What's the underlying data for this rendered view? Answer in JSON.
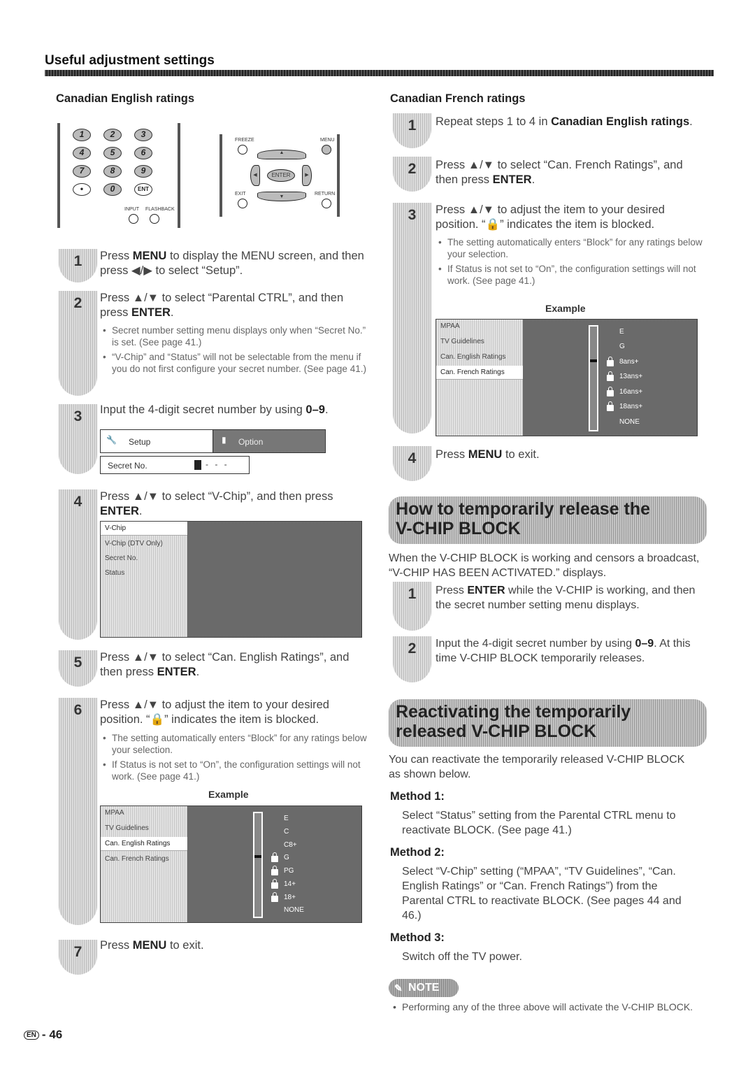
{
  "page": {
    "header": "Useful adjustment settings",
    "number": "46",
    "lang_badge": "EN",
    "separator": "-"
  },
  "english": {
    "title": "Canadian English ratings",
    "remote_numpad": {
      "buttons": [
        "1",
        "2",
        "3",
        "4",
        "5",
        "6",
        "7",
        "8",
        "9",
        "•",
        "0",
        "ENT"
      ],
      "labels": [
        "INPUT",
        "FLASHBACK"
      ]
    },
    "remote_dpad": {
      "labels": [
        "FREEZE",
        "MENU",
        "EXIT",
        "RETURN"
      ],
      "center": "ENTER"
    },
    "steps": [
      {
        "num": "1",
        "parts": [
          "Press ",
          "MENU",
          " to display the MENU screen, and then press ◀/▶ to select “Setup”."
        ]
      },
      {
        "num": "2",
        "parts": [
          "Press ▲/▼ to select “Parental CTRL”, and then press ",
          "ENTER",
          "."
        ],
        "bullets": [
          "Secret number setting menu displays only when “Secret No.” is set. (See page 41.)",
          "“V-Chip” and “Status” will not be selectable from the menu if you do not first configure your secret number. (See page 41.)"
        ]
      },
      {
        "num": "3",
        "parts": [
          "Input the 4-digit secret number by using ",
          "0–9",
          "."
        ]
      },
      {
        "num": "4",
        "parts": [
          "Press ▲/▼ to select “V-Chip”, and then press ",
          "ENTER",
          "."
        ]
      },
      {
        "num": "5",
        "parts": [
          "Press ▲/▼ to select “Can. English Ratings”, and then press ",
          "ENTER",
          "."
        ]
      },
      {
        "num": "6",
        "parts": [
          "Press ▲/▼ to adjust the item to your desired position. “🔒” indicates the item is blocked.",
          "",
          ""
        ],
        "bullets": [
          "The setting automatically enters “Block” for any ratings below your selection.",
          "If Status is not set to “On”, the configuration settings will not work. (See page 41.)"
        ]
      },
      {
        "num": "7",
        "parts": [
          "Press ",
          "MENU",
          " to exit."
        ]
      }
    ],
    "setup_screen": {
      "tab_active": "Setup",
      "tab_inactive": "Option",
      "field_label": "Secret No.",
      "field_value": "- - -"
    },
    "vchip_screen": {
      "selected": "V-Chip",
      "items": [
        "V-Chip (DTV Only)",
        "Secret No.",
        "Status"
      ]
    },
    "example_label": "Example",
    "example_screen": {
      "menu": [
        "MPAA",
        "TV Guidelines",
        "Can. English Ratings",
        "Can. French Ratings"
      ],
      "selected_index": 2,
      "ratings": [
        "E",
        "C",
        "C8+",
        "G",
        "PG",
        "14+",
        "18+",
        "NONE"
      ],
      "locked": [
        false,
        false,
        false,
        true,
        true,
        true,
        true,
        false
      ]
    }
  },
  "french": {
    "title": "Canadian French ratings",
    "steps": [
      {
        "num": "1",
        "parts": [
          "Repeat steps 1 to 4 in ",
          "Canadian English ratings",
          "."
        ]
      },
      {
        "num": "2",
        "parts": [
          "Press ▲/▼ to select “Can. French Ratings”, and then press ",
          "ENTER",
          "."
        ]
      },
      {
        "num": "3",
        "parts": [
          "Press ▲/▼ to adjust the item to your desired position. “🔒” indicates the item is blocked.",
          "",
          ""
        ],
        "bullets": [
          "The setting automatically enters “Block” for any ratings below your selection.",
          "If Status is not set to “On”, the configuration settings will not work. (See page 41.)"
        ]
      },
      {
        "num": "4",
        "parts": [
          "Press ",
          "MENU",
          " to exit."
        ]
      }
    ],
    "example_label": "Example",
    "example_screen": {
      "menu": [
        "MPAA",
        "TV Guidelines",
        "Can. English Ratings",
        "Can. French Ratings"
      ],
      "selected_index": 3,
      "ratings": [
        "E",
        "G",
        "8ans+",
        "13ans+",
        "16ans+",
        "18ans+",
        "NONE"
      ],
      "locked": [
        false,
        false,
        true,
        true,
        true,
        true,
        false
      ]
    }
  },
  "release": {
    "title_line1": "How to temporarily release the",
    "title_line2": "V-CHIP BLOCK",
    "intro": "When the V-CHIP BLOCK is working and censors a broadcast, “V-CHIP HAS BEEN ACTIVATED.” displays.",
    "steps": [
      {
        "num": "1",
        "parts": [
          "Press ",
          "ENTER",
          " while the V-CHIP is working, and then the secret number setting menu displays."
        ]
      },
      {
        "num": "2",
        "parts": [
          "Input the 4-digit secret number by using ",
          "0–9",
          ". At this time V-CHIP BLOCK temporarily releases."
        ]
      }
    ]
  },
  "reactivate": {
    "title_line1": "Reactivating the temporarily",
    "title_line2": "released V-CHIP BLOCK",
    "intro": "You can reactivate the temporarily released V-CHIP BLOCK as shown below.",
    "methods": [
      {
        "title": "Method 1:",
        "text": "Select “Status” setting from the Parental CTRL menu to reactivate BLOCK. (See page 41.)"
      },
      {
        "title": "Method 2:",
        "text": "Select “V-Chip” setting (“MPAA”, “TV Guidelines”, “Can. English Ratings” or “Can. French Ratings”) from the Parental CTRL to reactivate BLOCK. (See pages 44 and 46.)"
      },
      {
        "title": "Method 3:",
        "text": "Switch off the TV power."
      }
    ],
    "note_label": "NOTE",
    "note": "Performing any of the three above will activate the V-CHIP BLOCK."
  }
}
